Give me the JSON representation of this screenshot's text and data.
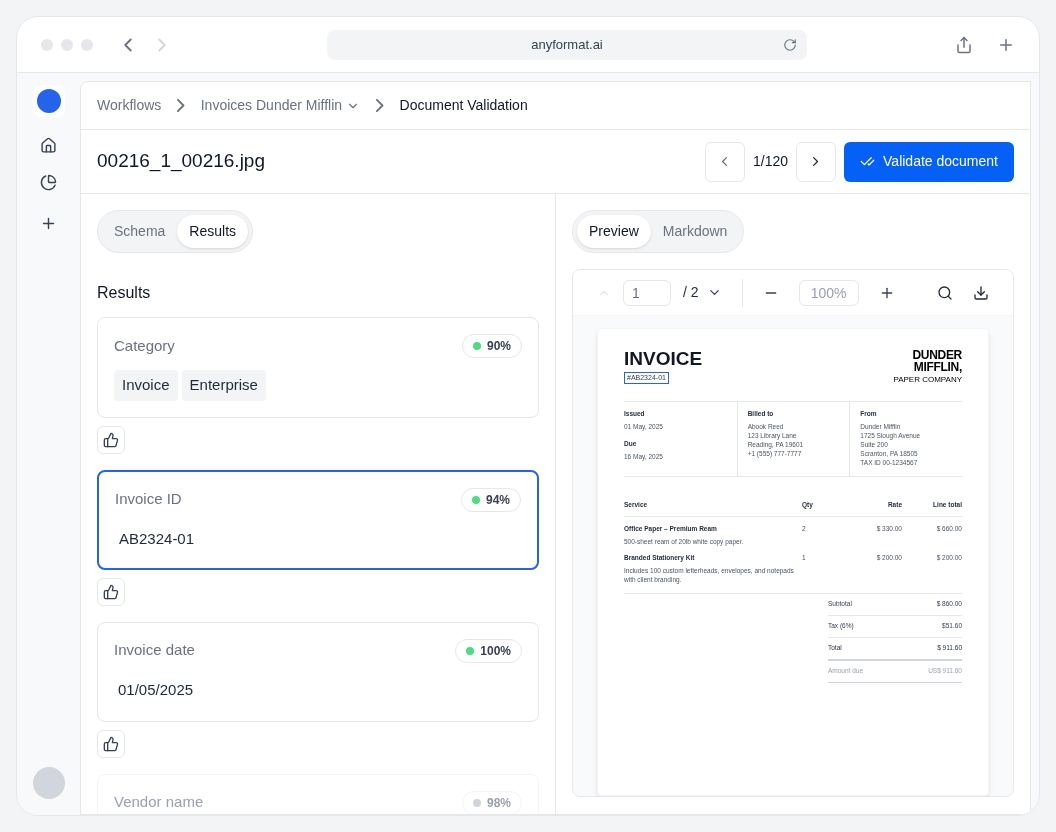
{
  "browser": {
    "url": "anyformat.ai"
  },
  "breadcrumbs": [
    {
      "label": "Workflows",
      "kind": "link"
    },
    {
      "label": "Invoices Dunder Mifflin",
      "kind": "dropdown"
    },
    {
      "label": "Document Validation",
      "kind": "current"
    }
  ],
  "document": {
    "title": "00216_1_00216.jpg",
    "counter": "1/120",
    "validate_button": "Validate document"
  },
  "left_tabs": [
    {
      "label": "Schema",
      "selected": false
    },
    {
      "label": "Results",
      "selected": true
    }
  ],
  "results": {
    "heading": "Results",
    "fields": [
      {
        "label": "Category",
        "confidence": "90%",
        "color": "#4ade80",
        "kind": "tags",
        "tags": [
          "Invoice",
          "Enterprise"
        ],
        "selected": false,
        "faded": false
      },
      {
        "label": "Invoice ID",
        "confidence": "94%",
        "color": "#4ade80",
        "kind": "value",
        "value": "AB2324-01",
        "selected": true,
        "faded": false
      },
      {
        "label": "Invoice date",
        "confidence": "100%",
        "color": "#4ade80",
        "kind": "value",
        "value": "01/05/2025",
        "selected": false,
        "faded": false
      },
      {
        "label": "Vendor name",
        "confidence": "98%",
        "color": "#d1d5db",
        "kind": "value",
        "selected": false,
        "faded": true
      }
    ]
  },
  "right_tabs": [
    {
      "label": "Preview",
      "selected": true
    },
    {
      "label": "Markdown",
      "selected": false
    }
  ],
  "viewer": {
    "page": "1",
    "pages": "/ 2",
    "zoom": "100%"
  },
  "invoice": {
    "title": "INVOICE",
    "number": "#AB2324-01",
    "logo": [
      "DUNDER",
      "MIFFLIN,",
      "PAPER COMPANY"
    ],
    "info": [
      {
        "blocks": [
          {
            "heading": "Issued",
            "lines": [
              "01 May, 2025"
            ]
          },
          {
            "heading": "Due",
            "lines": [
              "16 May, 2025"
            ]
          }
        ]
      },
      {
        "blocks": [
          {
            "heading": "Billed to",
            "lines": [
              "Abook Reed",
              "123 Library Lane",
              "Reading, PA 19601",
              "+1 (555) 777-7777"
            ]
          }
        ]
      },
      {
        "blocks": [
          {
            "heading": "From",
            "lines": [
              "Dunder Mifflin",
              "1725 Slough Avenue",
              "Suite 200",
              "Scranton, PA 18505",
              "TAX ID 00-1234567"
            ]
          }
        ]
      }
    ],
    "columns": [
      "Service",
      "Qty",
      "Rate",
      "Line total"
    ],
    "items": [
      {
        "name": "Office Paper – Premium Ream",
        "description": "500-sheet ream of 20lb white copy paper.",
        "qty": "2",
        "rate": "$ 330.00",
        "total": "$ 660.00"
      },
      {
        "name": "Branded Stationery Kit",
        "description": "Includes 100 custom letterheads, envelopes, and notepads with client branding.",
        "qty": "1",
        "rate": "$ 200.00",
        "total": "$ 200.00"
      }
    ],
    "totals": [
      {
        "label": "Subtotal",
        "value": "$ 860.00",
        "kind": "normal"
      },
      {
        "label": "Tax (6%)",
        "value": "$51.60",
        "kind": "normal"
      },
      {
        "label": "Total",
        "value": "$ 911.60",
        "kind": "total"
      },
      {
        "label": "Amount due",
        "value": "US$ 911.60",
        "kind": "muted"
      }
    ]
  }
}
